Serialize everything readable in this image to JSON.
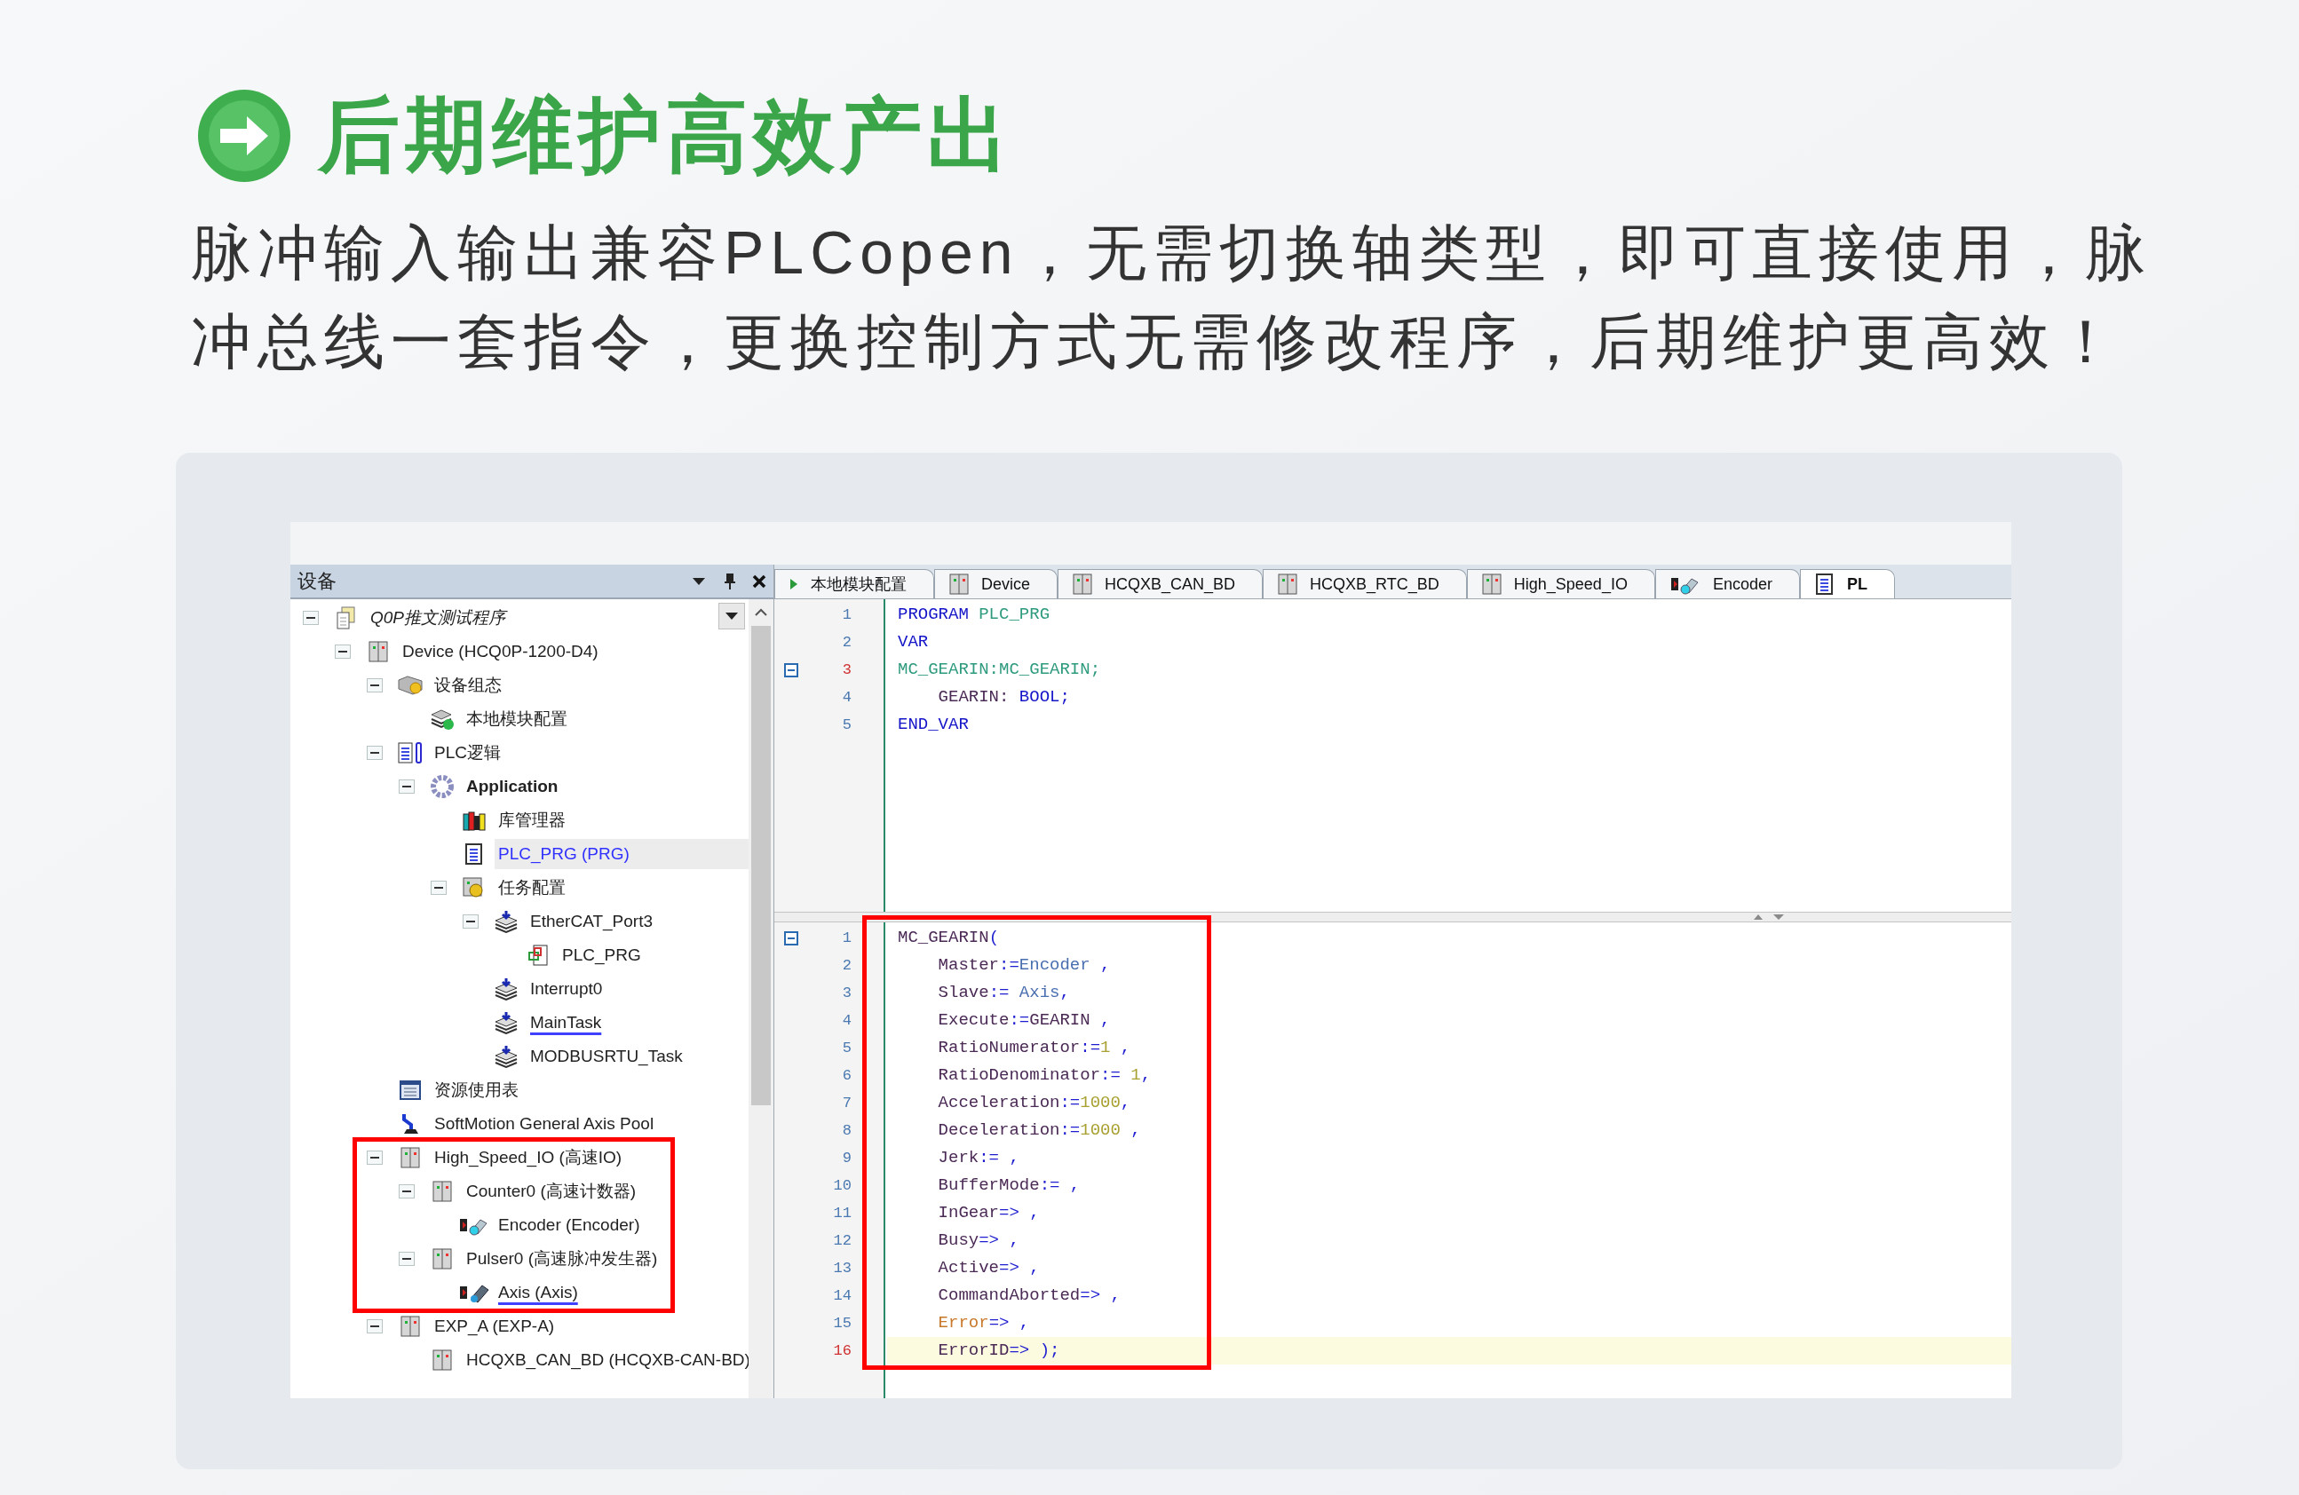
{
  "header": {
    "title": "后期维护高效产出",
    "description": "脉冲输入输出兼容PLCopen，无需切换轴类型，即可直接使用，脉冲总线一套指令，更换控制方式无需修改程序，后期维护更高效！"
  },
  "screen": {
    "device_panel": {
      "title": "设备",
      "tree": [
        {
          "label": "Q0P推文测试程序",
          "kind": "document",
          "active": false,
          "selected": false,
          "underlined": false,
          "highlighted": false,
          "expanded": true,
          "children": [
            {
              "label": "Device (HCQ0P-1200-D4)",
              "kind": "device",
              "active": false,
              "selected": false,
              "underlined": false,
              "highlighted": false,
              "expanded": true,
              "children": [
                {
                  "label": "设备组态",
                  "kind": "config",
                  "active": false,
                  "selected": false,
                  "underlined": false,
                  "highlighted": false,
                  "expanded": true,
                  "children": [
                    {
                      "label": "本地模块配置",
                      "kind": "module",
                      "active": false,
                      "selected": false,
                      "underlined": false,
                      "highlighted": false
                    }
                  ]
                },
                {
                  "label": "PLC逻辑",
                  "kind": "logic",
                  "active": false,
                  "selected": false,
                  "underlined": false,
                  "highlighted": false,
                  "expanded": true,
                  "children": [
                    {
                      "label": "Application",
                      "kind": "gear",
                      "active": true,
                      "selected": false,
                      "underlined": false,
                      "highlighted": false,
                      "expanded": true,
                      "children": [
                        {
                          "label": "库管理器",
                          "kind": "library",
                          "active": false,
                          "selected": false,
                          "underlined": false,
                          "highlighted": false
                        },
                        {
                          "label": "PLC_PRG (PRG)",
                          "kind": "program",
                          "active": false,
                          "selected": true,
                          "underlined": false,
                          "highlighted": false
                        },
                        {
                          "label": "任务配置",
                          "kind": "tasks",
                          "active": false,
                          "selected": false,
                          "underlined": false,
                          "highlighted": false,
                          "expanded": true,
                          "children": [
                            {
                              "label": "EtherCAT_Port3",
                              "kind": "task",
                              "active": false,
                              "selected": false,
                              "underlined": false,
                              "highlighted": false,
                              "expanded": true,
                              "children": [
                                {
                                  "label": "PLC_PRG",
                                  "kind": "call",
                                  "active": false,
                                  "selected": false,
                                  "underlined": false,
                                  "highlighted": false
                                }
                              ]
                            },
                            {
                              "label": "Interrupt0",
                              "kind": "task",
                              "active": false,
                              "selected": false,
                              "underlined": false,
                              "highlighted": false
                            },
                            {
                              "label": "MainTask",
                              "kind": "task",
                              "active": false,
                              "selected": false,
                              "underlined": true,
                              "highlighted": false
                            },
                            {
                              "label": "MODBUSRTU_Task",
                              "kind": "task",
                              "active": false,
                              "selected": false,
                              "underlined": false,
                              "highlighted": false
                            }
                          ]
                        }
                      ]
                    }
                  ]
                },
                {
                  "label": "资源使用表",
                  "kind": "table",
                  "active": false,
                  "selected": false,
                  "underlined": false,
                  "highlighted": false
                },
                {
                  "label": "SoftMotion General Axis Pool",
                  "kind": "arm",
                  "active": false,
                  "selected": false,
                  "underlined": false,
                  "highlighted": false
                },
                {
                  "label": "High_Speed_IO (高速IO)",
                  "kind": "device",
                  "active": false,
                  "selected": false,
                  "underlined": false,
                  "highlighted": true,
                  "expanded": true,
                  "children": [
                    {
                      "label": "Counter0 (高速计数器)",
                      "kind": "device",
                      "active": false,
                      "selected": false,
                      "underlined": false,
                      "highlighted": false,
                      "expanded": true,
                      "children": [
                        {
                          "label": "Encoder (Encoder)",
                          "kind": "encoder",
                          "active": false,
                          "selected": false,
                          "underlined": false,
                          "highlighted": false
                        }
                      ]
                    },
                    {
                      "label": "Pulser0 (高速脉冲发生器)",
                      "kind": "device",
                      "active": false,
                      "selected": false,
                      "underlined": false,
                      "highlighted": false,
                      "expanded": true,
                      "children": [
                        {
                          "label": "Axis (Axis)",
                          "kind": "axis",
                          "active": false,
                          "selected": false,
                          "underlined": true,
                          "highlighted": false
                        }
                      ]
                    }
                  ]
                },
                {
                  "label": "EXP_A (EXP-A)",
                  "kind": "device",
                  "active": false,
                  "selected": false,
                  "underlined": false,
                  "highlighted": false,
                  "expanded": true,
                  "children": [
                    {
                      "label": "HCQXB_CAN_BD (HCQXB-CAN-BD)",
                      "kind": "device",
                      "active": false,
                      "selected": false,
                      "underlined": false,
                      "highlighted": false
                    }
                  ]
                }
              ]
            }
          ]
        }
      ]
    },
    "editor": {
      "tabs": [
        {
          "label": "本地模块配置",
          "kind": "arrow",
          "selected": false
        },
        {
          "label": "Device",
          "kind": "device",
          "selected": false
        },
        {
          "label": "HCQXB_CAN_BD",
          "kind": "device",
          "selected": false
        },
        {
          "label": "HCQXB_RTC_BD",
          "kind": "device",
          "selected": false
        },
        {
          "label": "High_Speed_IO",
          "kind": "device",
          "selected": false
        },
        {
          "label": "Encoder",
          "kind": "encoder",
          "selected": false
        },
        {
          "label": "PL",
          "kind": "program",
          "selected": true
        }
      ],
      "declaration": {
        "highlighted": false,
        "lines": [
          {
            "number": "1",
            "current": false,
            "highlighted": false,
            "fold": false,
            "tokens": [
              {
                "text": "PROGRAM ",
                "kind": "keyword"
              },
              {
                "text": "PLC_PRG",
                "kind": "name"
              }
            ]
          },
          {
            "number": "2",
            "current": false,
            "highlighted": false,
            "fold": false,
            "tokens": [
              {
                "text": "VAR",
                "kind": "keyword"
              }
            ]
          },
          {
            "number": "3",
            "current": true,
            "highlighted": false,
            "fold": true,
            "tokens": [
              {
                "text": "MC_GEARIN:MC_GEARIN;",
                "kind": "name"
              }
            ]
          },
          {
            "number": "4",
            "current": false,
            "highlighted": false,
            "fold": false,
            "tokens": [
              {
                "text": "    GEARIN: ",
                "kind": "variable"
              },
              {
                "text": "BOOL;",
                "kind": "keyword"
              }
            ]
          },
          {
            "number": "5",
            "current": false,
            "highlighted": false,
            "fold": false,
            "tokens": [
              {
                "text": "END_VAR",
                "kind": "keyword"
              }
            ]
          }
        ]
      },
      "implementation": {
        "highlighted": true,
        "lines": [
          {
            "number": "1",
            "current": false,
            "highlighted": false,
            "fold": true,
            "tokens": [
              {
                "text": "MC_GEARIN",
                "kind": "variable"
              },
              {
                "text": "(",
                "kind": "operator"
              }
            ]
          },
          {
            "number": "2",
            "current": false,
            "highlighted": false,
            "fold": false,
            "tokens": [
              {
                "text": "    Master",
                "kind": "variable"
              },
              {
                "text": ":=",
                "kind": "operator"
              },
              {
                "text": "Encoder",
                "kind": "reference"
              },
              {
                "text": " ,",
                "kind": "operator"
              }
            ]
          },
          {
            "number": "3",
            "current": false,
            "highlighted": false,
            "fold": false,
            "tokens": [
              {
                "text": "    Slave",
                "kind": "variable"
              },
              {
                "text": ":= ",
                "kind": "operator"
              },
              {
                "text": "Axis",
                "kind": "reference"
              },
              {
                "text": ",",
                "kind": "operator"
              }
            ]
          },
          {
            "number": "4",
            "current": false,
            "highlighted": false,
            "fold": false,
            "tokens": [
              {
                "text": "    Execute",
                "kind": "variable"
              },
              {
                "text": ":=",
                "kind": "operator"
              },
              {
                "text": "GEARIN",
                "kind": "variable"
              },
              {
                "text": " ,",
                "kind": "operator"
              }
            ]
          },
          {
            "number": "5",
            "current": false,
            "highlighted": false,
            "fold": false,
            "tokens": [
              {
                "text": "    RatioNumerator",
                "kind": "variable"
              },
              {
                "text": ":=",
                "kind": "operator"
              },
              {
                "text": "1",
                "kind": "number"
              },
              {
                "text": " ,",
                "kind": "operator"
              }
            ]
          },
          {
            "number": "6",
            "current": false,
            "highlighted": false,
            "fold": false,
            "tokens": [
              {
                "text": "    RatioDenominator",
                "kind": "variable"
              },
              {
                "text": ":= ",
                "kind": "operator"
              },
              {
                "text": "1",
                "kind": "number"
              },
              {
                "text": ",",
                "kind": "operator"
              }
            ]
          },
          {
            "number": "7",
            "current": false,
            "highlighted": false,
            "fold": false,
            "tokens": [
              {
                "text": "    Acceleration",
                "kind": "variable"
              },
              {
                "text": ":=",
                "kind": "operator"
              },
              {
                "text": "1000",
                "kind": "number"
              },
              {
                "text": ",",
                "kind": "operator"
              }
            ]
          },
          {
            "number": "8",
            "current": false,
            "highlighted": false,
            "fold": false,
            "tokens": [
              {
                "text": "    Deceleration",
                "kind": "variable"
              },
              {
                "text": ":=",
                "kind": "operator"
              },
              {
                "text": "1000",
                "kind": "number"
              },
              {
                "text": " ,",
                "kind": "operator"
              }
            ]
          },
          {
            "number": "9",
            "current": false,
            "highlighted": false,
            "fold": false,
            "tokens": [
              {
                "text": "    Jerk",
                "kind": "variable"
              },
              {
                "text": ":= ,",
                "kind": "operator"
              }
            ]
          },
          {
            "number": "10",
            "current": false,
            "highlighted": false,
            "fold": false,
            "tokens": [
              {
                "text": "    BufferMode",
                "kind": "variable"
              },
              {
                "text": ":= ,",
                "kind": "operator"
              }
            ]
          },
          {
            "number": "11",
            "current": false,
            "highlighted": false,
            "fold": false,
            "tokens": [
              {
                "text": "    InGear",
                "kind": "variable"
              },
              {
                "text": "=> ,",
                "kind": "operator"
              }
            ]
          },
          {
            "number": "12",
            "current": false,
            "highlighted": false,
            "fold": false,
            "tokens": [
              {
                "text": "    Busy",
                "kind": "variable"
              },
              {
                "text": "=> ,",
                "kind": "operator"
              }
            ]
          },
          {
            "number": "13",
            "current": false,
            "highlighted": false,
            "fold": false,
            "tokens": [
              {
                "text": "    Active",
                "kind": "variable"
              },
              {
                "text": "=> ,",
                "kind": "operator"
              }
            ]
          },
          {
            "number": "14",
            "current": false,
            "highlighted": false,
            "fold": false,
            "tokens": [
              {
                "text": "    CommandAborted",
                "kind": "variable"
              },
              {
                "text": "=> ,",
                "kind": "operator"
              }
            ]
          },
          {
            "number": "15",
            "current": false,
            "highlighted": false,
            "fold": false,
            "tokens": [
              {
                "text": "    Error",
                "kind": "error"
              },
              {
                "text": "=> ,",
                "kind": "operator"
              }
            ]
          },
          {
            "number": "16",
            "current": true,
            "highlighted": true,
            "fold": false,
            "tokens": [
              {
                "text": "    ErrorID",
                "kind": "variable"
              },
              {
                "text": "=> );",
                "kind": "operator"
              }
            ]
          }
        ]
      }
    }
  }
}
